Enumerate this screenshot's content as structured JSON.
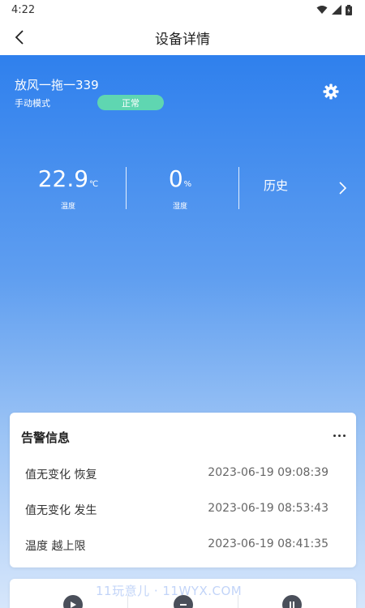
{
  "status_bar": {
    "time": "4:22"
  },
  "nav": {
    "title": "设备详情"
  },
  "device": {
    "name": "放风一拖一339",
    "mode": "手动模式",
    "status": "正常"
  },
  "stats": {
    "temperature": {
      "value": "22.9",
      "unit": "℃",
      "label": "温度"
    },
    "humidity": {
      "value": "0",
      "unit": "%",
      "label": "湿度"
    },
    "history_label": "历史"
  },
  "alarms": {
    "title": "告警信息",
    "rows": [
      {
        "desc": "值无变化 恢复",
        "time": "2023-06-19 09:08:39"
      },
      {
        "desc": "值无变化 发生",
        "time": "2023-06-19 08:53:43"
      },
      {
        "desc": "温度 越上限",
        "time": "2023-06-19 08:41:35"
      }
    ]
  },
  "watermark": "11玩意儿 · 11WYX.COM",
  "colors": {
    "accent": "#2f80ed",
    "status_pill": "#5fd6b1"
  },
  "icons": {
    "back": "chevron-left-icon",
    "settings": "gear-icon",
    "history_arrow": "chevron-right-icon",
    "more": "more-icon"
  }
}
